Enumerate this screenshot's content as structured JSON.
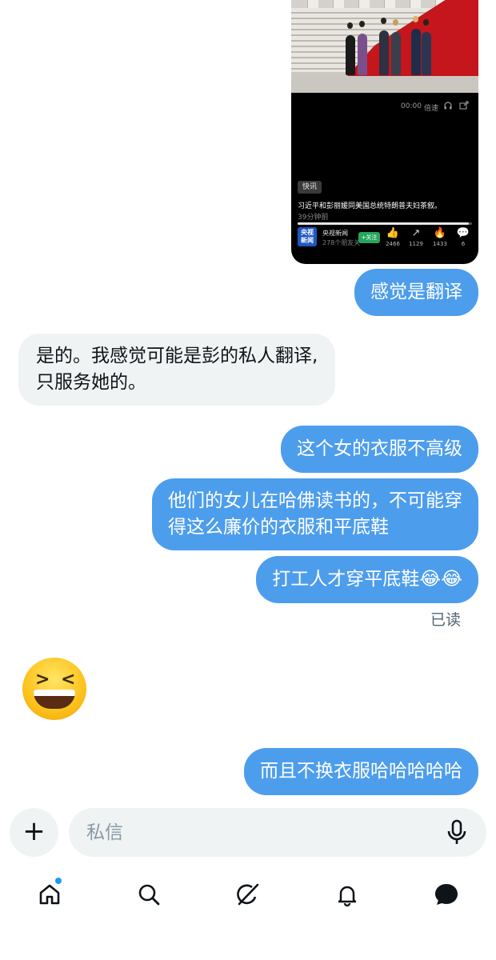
{
  "video_card": {
    "controls": {
      "time": "00:00",
      "speed_label": "倍速",
      "headphone_icon": "headphones-icon",
      "share_icon": "share-screen-icon"
    },
    "tag": "快讯",
    "headline": "习近平和彭丽媛同美国总统特朗普夫妇茶叙。",
    "time_ago": "39分钟前",
    "progress": 0.98,
    "channel": {
      "logo_text": "央视新闻",
      "name": "央视新闻",
      "followers": "278个朋友关",
      "follow_label": "+关注"
    },
    "stats": [
      {
        "icon": "thumbs-up-icon",
        "glyph": "👍",
        "value": "2466"
      },
      {
        "icon": "share-icon",
        "glyph": "↗",
        "value": "1129"
      },
      {
        "icon": "flame-icon",
        "glyph": "🔥",
        "value": "1433"
      },
      {
        "icon": "comment-icon",
        "glyph": "💬",
        "value": "6"
      }
    ]
  },
  "messages": [
    {
      "direction": "out",
      "text": "感觉是翻译"
    },
    {
      "direction": "in",
      "lines": [
        "是的。我感觉可能是彭的私人翻译,",
        "只服务她的。"
      ]
    },
    {
      "direction": "out",
      "text": "这个女的衣服不高级"
    },
    {
      "direction": "out",
      "lines": [
        "他们的女儿在哈佛读书的，不可能穿",
        "得这么廉价的衣服和平底鞋"
      ]
    },
    {
      "direction": "out",
      "text": "打工人才穿平底鞋😂😂"
    },
    {
      "direction": "in",
      "emoji": "grinning-squinting-face"
    },
    {
      "direction": "out",
      "text": "而且不换衣服哈哈哈哈哈"
    }
  ],
  "read_receipt": "已读",
  "composer": {
    "add_icon": "plus-icon",
    "add_glyph": "+",
    "placeholder": "私信",
    "mic_icon": "microphone-icon"
  },
  "tabbar": {
    "items": [
      "home-icon",
      "search-icon",
      "grok-icon",
      "bell-icon",
      "messages-icon"
    ],
    "notification_dot_color": "#1d9bf0"
  },
  "colors": {
    "outgoing_bubble": "#4d9ded",
    "incoming_bubble": "#eff3f4"
  }
}
